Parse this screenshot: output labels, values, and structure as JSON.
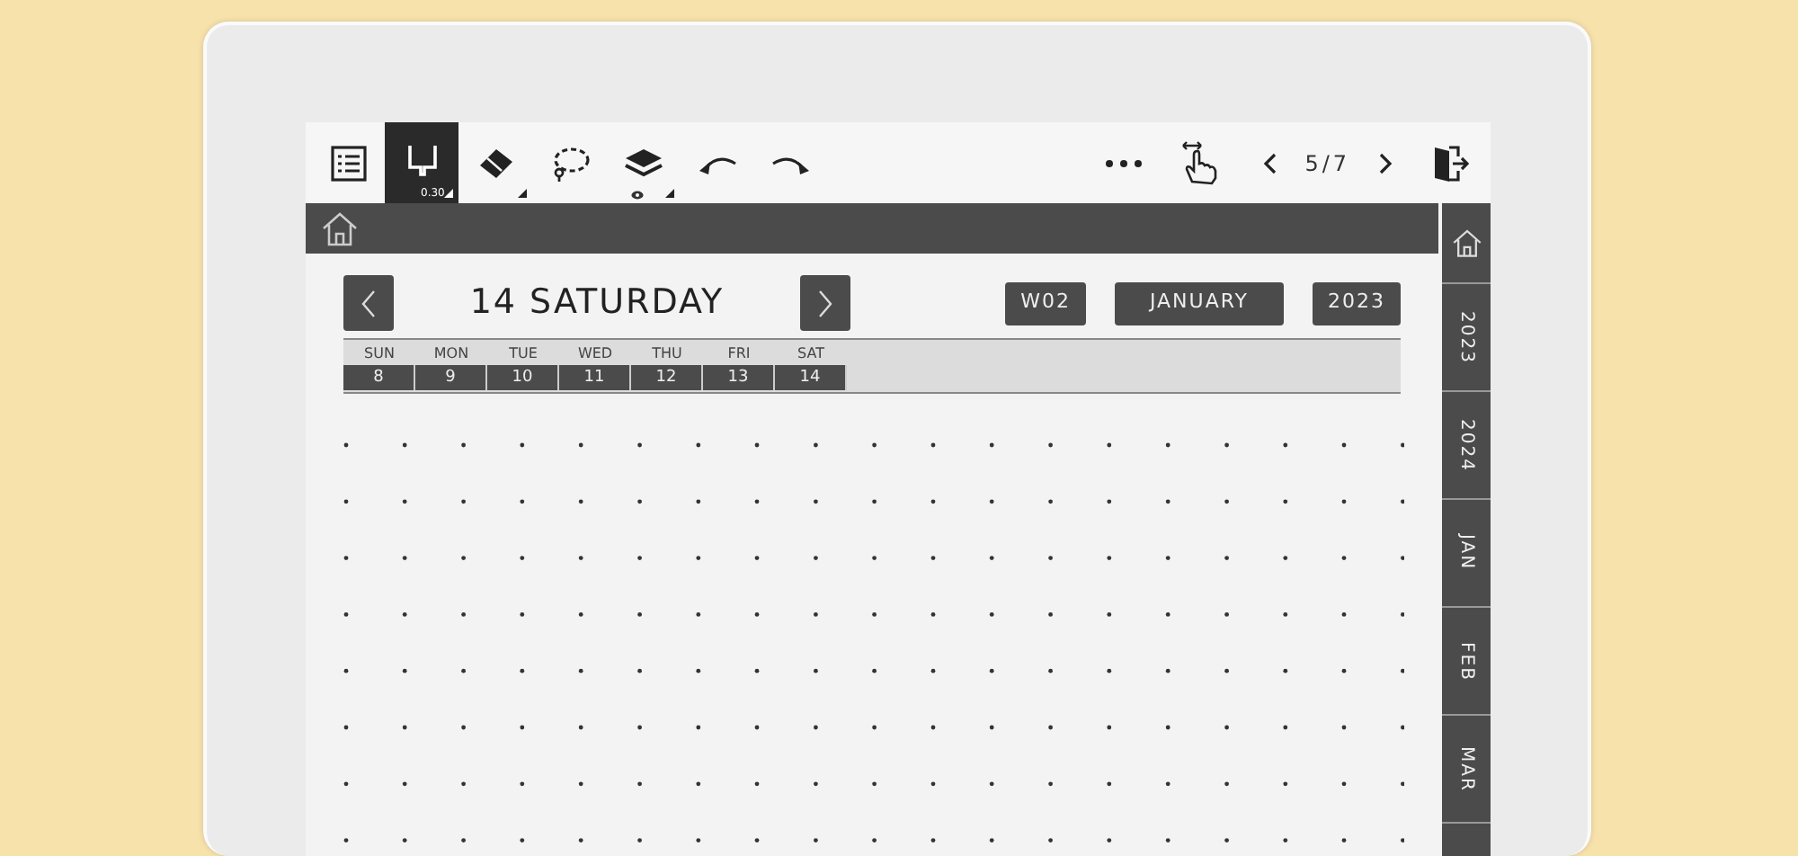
{
  "toolbar": {
    "tools": [
      {
        "kind": "toc",
        "selected": false
      },
      {
        "kind": "pen",
        "selected": true,
        "size": "0.30"
      },
      {
        "kind": "eraser",
        "selected": false
      },
      {
        "kind": "lasso",
        "selected": false
      },
      {
        "kind": "layers",
        "selected": false
      },
      {
        "kind": "undo",
        "selected": false
      },
      {
        "kind": "redo",
        "selected": false
      }
    ],
    "page": "5/7"
  },
  "header": {
    "title": "14 SATURDAY",
    "week": "W02",
    "month": "JANUARY",
    "year": "2023"
  },
  "week_days": [
    {
      "name": "SUN",
      "date": "8"
    },
    {
      "name": "MON",
      "date": "9"
    },
    {
      "name": "TUE",
      "date": "10"
    },
    {
      "name": "WED",
      "date": "11"
    },
    {
      "name": "THU",
      "date": "12"
    },
    {
      "name": "FRI",
      "date": "13"
    },
    {
      "name": "SAT",
      "date": "14"
    }
  ],
  "side_tabs": [
    {
      "kind": "home"
    },
    {
      "kind": "text",
      "label": "2023"
    },
    {
      "kind": "text",
      "label": "2024"
    },
    {
      "kind": "text",
      "label": "JAN"
    },
    {
      "kind": "text",
      "label": "FEB"
    },
    {
      "kind": "text",
      "label": "MAR"
    },
    {
      "kind": "blank"
    }
  ]
}
